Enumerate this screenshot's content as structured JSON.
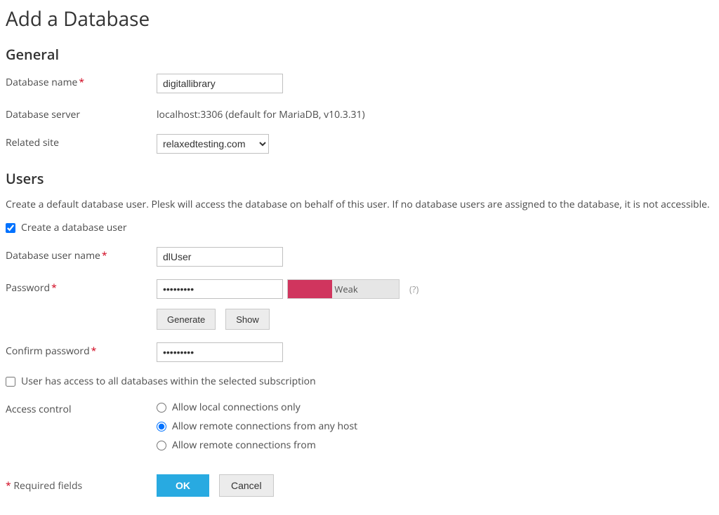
{
  "page": {
    "title": "Add a Database"
  },
  "general": {
    "heading": "General",
    "database_name_label": "Database name",
    "database_name_value": "digitallibrary",
    "database_server_label": "Database server",
    "database_server_value": "localhost:3306 (default for MariaDB, v10.3.31)",
    "related_site_label": "Related site",
    "related_site_value": "relaxedtesting.com"
  },
  "users": {
    "heading": "Users",
    "description": "Create a default database user. Plesk will access the database on behalf of this user. If no database users are assigned to the database, it is not accessible.",
    "create_user_label": "Create a database user",
    "create_user_checked": true,
    "db_user_name_label": "Database user name",
    "db_user_name_value": "dlUser",
    "password_label": "Password",
    "password_value": "•••••••••",
    "strength_text": "Weak",
    "help_text": "(?)",
    "generate_label": "Generate",
    "show_label": "Show",
    "confirm_password_label": "Confirm password",
    "confirm_password_value": "•••••••••",
    "all_db_access_label": "User has access to all databases within the selected subscription",
    "all_db_access_checked": false,
    "access_control_label": "Access control",
    "access_options": {
      "local_only": "Allow local connections only",
      "any_host": "Allow remote connections from any host",
      "from": "Allow remote connections from"
    },
    "access_selected": "any_host"
  },
  "footer": {
    "required_star": "*",
    "required_text": " Required fields",
    "ok_label": "OK",
    "cancel_label": "Cancel"
  }
}
